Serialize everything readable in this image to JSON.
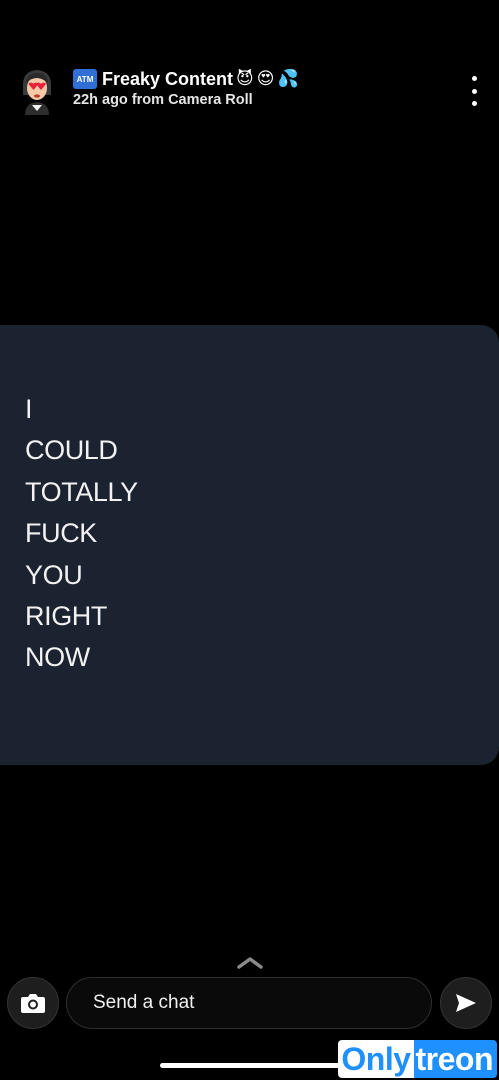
{
  "header": {
    "badge": "ATM",
    "title": "Freaky Content",
    "emojis": [
      "😈",
      "😍",
      "💦"
    ],
    "subtitle": "22h ago from Camera Roll",
    "avatar_icon": "bitmoji-avatar-icon",
    "menu_icon": "more-vertical-icon"
  },
  "media": {
    "lines": [
      "I",
      "COULD",
      "TOTALLY",
      "FUCK",
      "YOU",
      "RIGHT",
      "NOW"
    ],
    "background_color": "#1b2330"
  },
  "footer": {
    "camera_icon": "camera-icon",
    "chat_placeholder": "Send a chat",
    "send_icon": "send-arrow-icon",
    "swipe_icon": "chevron-up-icon"
  },
  "watermark": {
    "left": "Only",
    "right": "treon"
  }
}
